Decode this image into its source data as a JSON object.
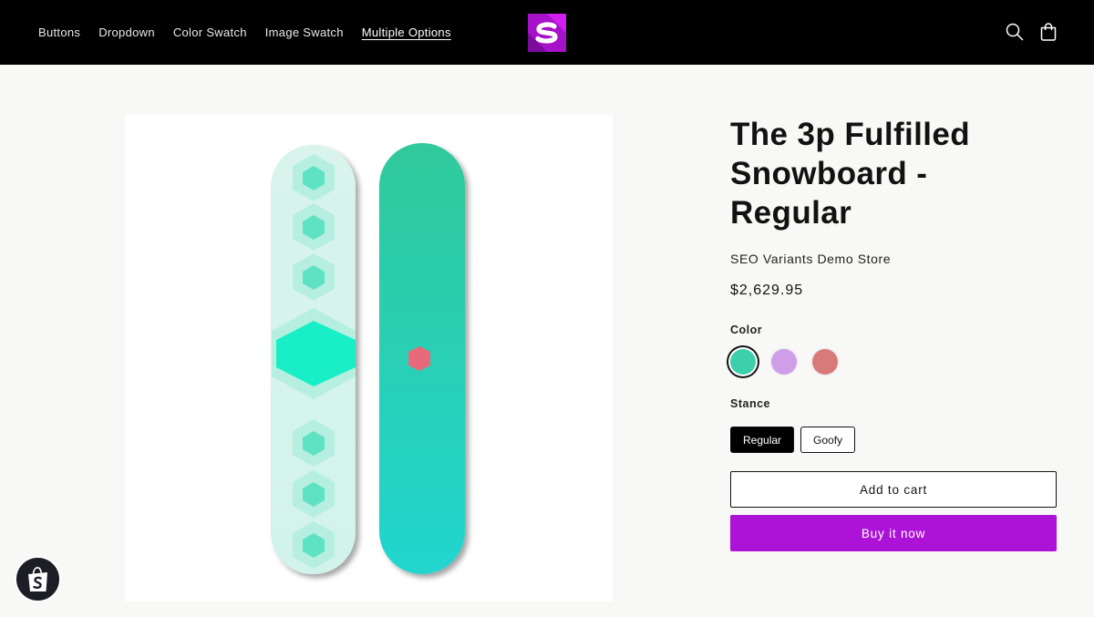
{
  "nav": {
    "links": [
      "Buttons",
      "Dropdown",
      "Color Swatch",
      "Image Swatch",
      "Multiple Options"
    ],
    "active": "Multiple Options"
  },
  "header": {
    "logo_icon": "store-logo-s",
    "search_icon": "search-icon",
    "cart_icon": "cart-icon",
    "background": "#000000"
  },
  "product": {
    "title": "The 3p Fulfilled Snowboard - Regular",
    "vendor": "SEO Variants Demo Store",
    "price": "$2,629.95"
  },
  "options": {
    "color": {
      "label": "Color",
      "swatches": [
        {
          "color": "#3dcfab",
          "selected": true
        },
        {
          "color": "#cf9ee8",
          "selected": false
        },
        {
          "color": "#d97a7a",
          "selected": false
        }
      ]
    },
    "stance": {
      "label": "Stance",
      "values": [
        "Regular",
        "Goofy"
      ],
      "selected": "Regular"
    }
  },
  "actions": {
    "add_to_cart": "Add to cart",
    "buy_now": "Buy it now",
    "accent": "#ad13d7"
  },
  "badge": {
    "icon": "shopify-bag-icon"
  }
}
